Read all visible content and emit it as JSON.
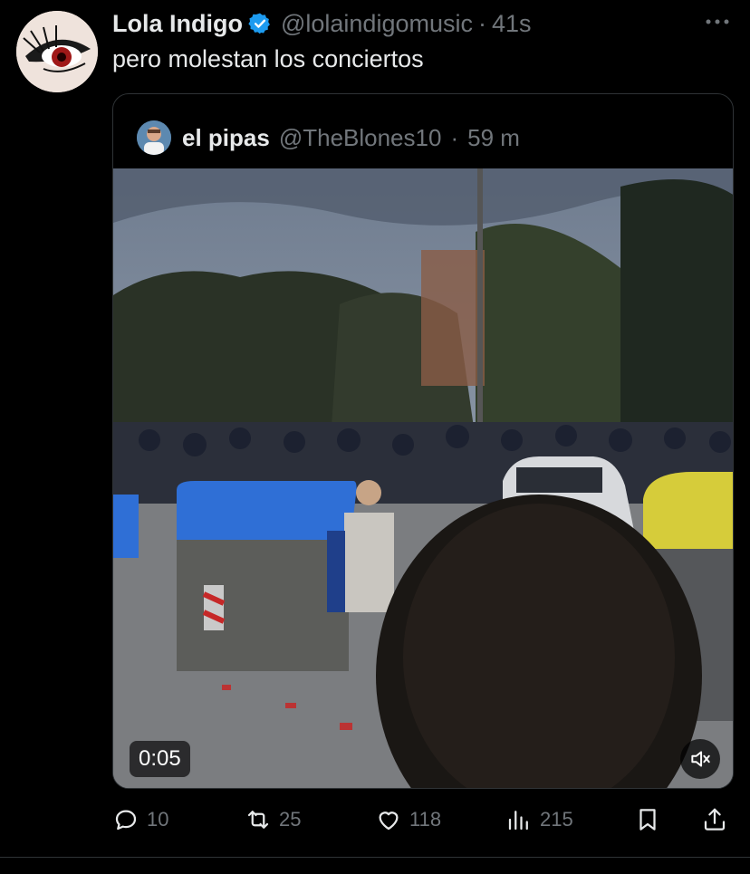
{
  "tweet": {
    "author_name": "Lola Indigo",
    "handle": "@lolaindigomusic",
    "separator": "·",
    "time": "41s",
    "text": "pero molestan los conciertos",
    "more_icon": "more-horizontal-icon",
    "verified_icon": "verified-badge-icon",
    "verified_color": "#1d9bf0"
  },
  "quoted_tweet": {
    "author_name": "el pipas",
    "handle": "@TheBlones10",
    "separator": "·",
    "time": "59 m",
    "video": {
      "duration": "0:05",
      "mute_icon": "volume-muted-icon"
    }
  },
  "actions": {
    "reply": {
      "icon": "reply-icon",
      "count": "10"
    },
    "retweet": {
      "icon": "retweet-icon",
      "count": "25"
    },
    "like": {
      "icon": "heart-icon",
      "count": "118"
    },
    "views": {
      "icon": "views-chart-icon",
      "count": "215"
    },
    "bookmark": {
      "icon": "bookmark-icon"
    },
    "share": {
      "icon": "share-icon"
    }
  },
  "colors": {
    "background": "#000000",
    "text_primary": "#e7e9ea",
    "text_secondary": "#71767b",
    "border": "#2f3336",
    "accent": "#1d9bf0"
  }
}
